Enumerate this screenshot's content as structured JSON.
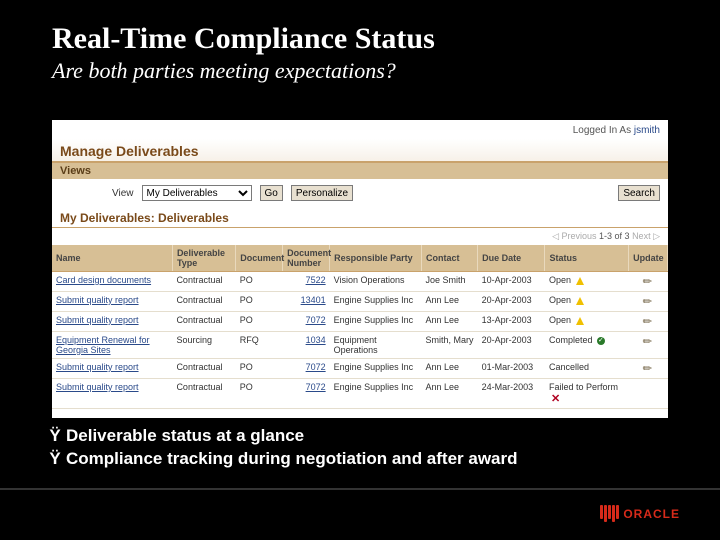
{
  "slide": {
    "title": "Real-Time Compliance Status",
    "subtitle": "Are both parties meeting expectations?"
  },
  "header": {
    "logged_in_label": "Logged In As",
    "user": "jsmith",
    "page_title": "Manage Deliverables",
    "views_band": "Views",
    "view_label": "View",
    "view_selected": "My Deliverables",
    "go_btn": "Go",
    "personalize_btn": "Personalize",
    "search_btn": "Search",
    "subhead": "My Deliverables: Deliverables"
  },
  "paging": {
    "prev": "◁ Previous",
    "range": "1-3 of 3",
    "next": "Next ▷"
  },
  "columns": {
    "name": "Name",
    "type": "Deliverable Type",
    "doc": "Document",
    "docnum": "Document Number",
    "resp": "Responsible Party",
    "contact": "Contact",
    "due": "Due Date",
    "status": "Status",
    "update": "Update"
  },
  "rows": [
    {
      "name": "Card design documents",
      "type": "Contractual",
      "doc": "PO",
      "docnum": "7522",
      "resp": "Vision Operations",
      "contact": "Joe Smith",
      "due": "10-Apr-2003",
      "status": "Open",
      "ico": "warn",
      "upd": true
    },
    {
      "name": "Submit quality report",
      "type": "Contractual",
      "doc": "PO",
      "docnum": "13401",
      "resp": "Engine Supplies Inc",
      "contact": "Ann Lee",
      "due": "20-Apr-2003",
      "status": "Open",
      "ico": "warn",
      "upd": true
    },
    {
      "name": "Submit quality report",
      "type": "Contractual",
      "doc": "PO",
      "docnum": "7072",
      "resp": "Engine Supplies Inc",
      "contact": "Ann Lee",
      "due": "13-Apr-2003",
      "status": "Open",
      "ico": "warn",
      "upd": true
    },
    {
      "name": "Equipment Renewal for Georgia Sites",
      "type": "Sourcing",
      "doc": "RFQ",
      "docnum": "1034",
      "resp": "Equipment Operations",
      "contact": "Smith, Mary",
      "due": "20-Apr-2003",
      "status": "Completed",
      "ico": "chk",
      "upd": true
    },
    {
      "name": "Submit quality report",
      "type": "Contractual",
      "doc": "PO",
      "docnum": "7072",
      "resp": "Engine Supplies Inc",
      "contact": "Ann Lee",
      "due": "01-Mar-2003",
      "status": "Cancelled",
      "ico": "",
      "upd": true
    },
    {
      "name": "Submit quality report",
      "type": "Contractual",
      "doc": "PO",
      "docnum": "7072",
      "resp": "Engine Supplies Inc",
      "contact": "Ann Lee",
      "due": "24-Mar-2003",
      "status": "Failed to Perform",
      "ico": "x",
      "upd": false
    }
  ],
  "bullets": [
    "Deliverable status at a glance",
    "Compliance tracking during negotiation and after award"
  ],
  "brand": "ORACLE"
}
